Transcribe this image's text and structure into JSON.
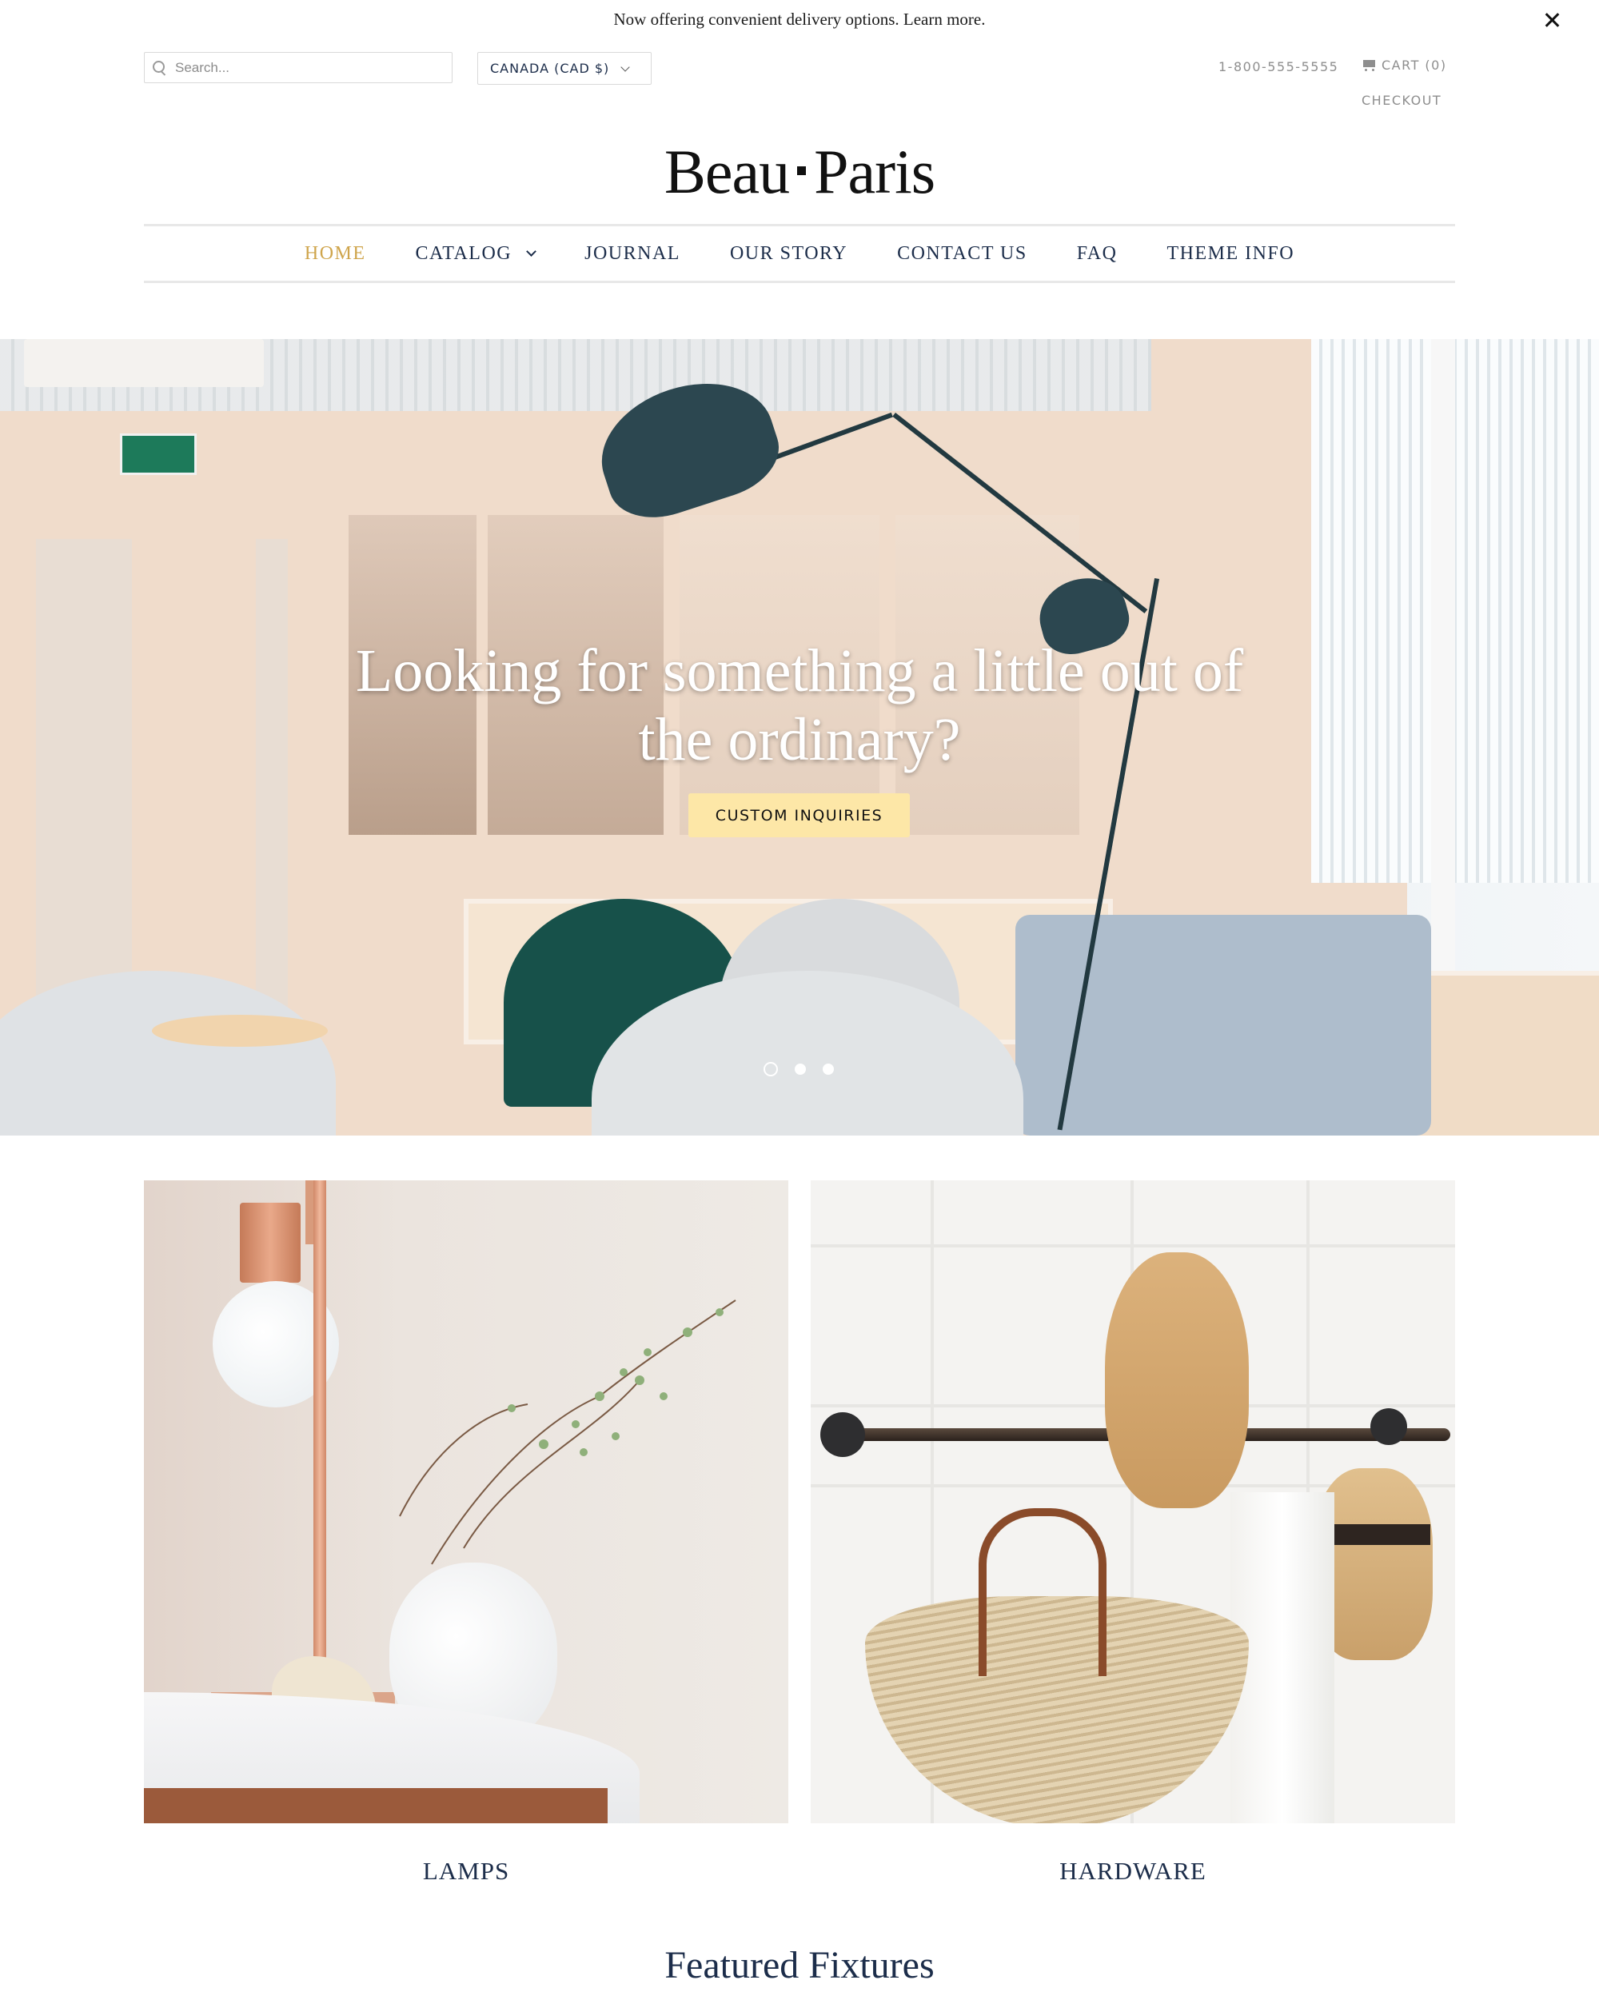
{
  "announcement": {
    "text": "Now offering convenient delivery options. Learn more.",
    "close_icon": "close-icon"
  },
  "header": {
    "search": {
      "placeholder": "Search...",
      "value": "",
      "icon": "search-icon"
    },
    "currency": {
      "selected": "CANADA (CAD $)",
      "icon": "chevron-down-icon"
    },
    "phone": "1-800-555-5555",
    "cart": {
      "label": "CART (0)",
      "icon": "cart-icon",
      "count": 0
    },
    "checkout": "CHECKOUT",
    "logo": {
      "left": "Beau",
      "right": "Paris"
    }
  },
  "nav": {
    "items": [
      {
        "label": "HOME",
        "active": true
      },
      {
        "label": "CATALOG",
        "has_dropdown": true
      },
      {
        "label": "JOURNAL"
      },
      {
        "label": "OUR STORY"
      },
      {
        "label": "CONTACT US"
      },
      {
        "label": "FAQ"
      },
      {
        "label": "THEME INFO"
      }
    ],
    "active_color": "#cfa54c",
    "text_color": "#1c2d4a"
  },
  "hero": {
    "title_line1": "Looking for something a little out of",
    "title_line2": "the ordinary?",
    "button_label": "CUSTOM INQUIRIES",
    "button_color": "#fde7a7",
    "slides": 3,
    "active_slide": 1
  },
  "categories": [
    {
      "label": "LAMPS"
    },
    {
      "label": "HARDWARE"
    }
  ],
  "featured": {
    "title": "Featured Fixtures"
  }
}
